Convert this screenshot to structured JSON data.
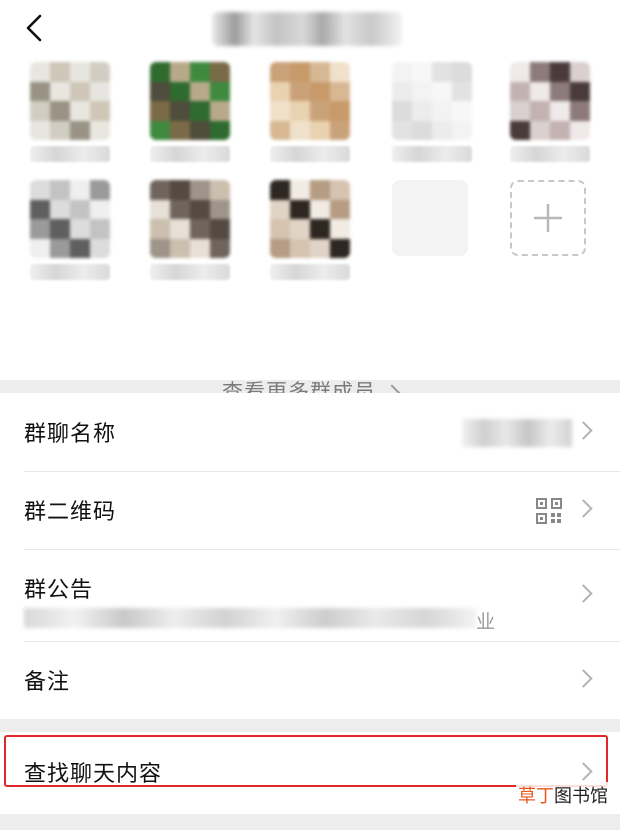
{
  "header": {
    "title_blurred": true
  },
  "members": [
    {
      "row": 0,
      "col": 0,
      "kind": "avatar",
      "colors": [
        "#e8e6df",
        "#d1cdc2",
        "#cfc6b8",
        "#9a9385",
        "#e7e5e0"
      ]
    },
    {
      "row": 0,
      "col": 1,
      "kind": "avatar",
      "colors": [
        "#3f8a3e",
        "#2f6b2f",
        "#7a6a47",
        "#b8a98a",
        "#4f4d3c"
      ]
    },
    {
      "row": 0,
      "col": 2,
      "kind": "avatar",
      "colors": [
        "#e9d2b0",
        "#d7b893",
        "#caa27a",
        "#f0e1cb",
        "#c89a6a"
      ]
    },
    {
      "row": 0,
      "col": 3,
      "kind": "avatar",
      "colors": [
        "#f7f7f7",
        "#ececec",
        "#e2e2e2",
        "#f3f3f3",
        "#dcdcdc"
      ]
    },
    {
      "row": 0,
      "col": 4,
      "kind": "avatar",
      "colors": [
        "#d9d0cf",
        "#8d7a7a",
        "#c4b2b2",
        "#4a3b3b",
        "#efe9e9"
      ]
    },
    {
      "row": 1,
      "col": 0,
      "kind": "avatar",
      "colors": [
        "#dcdcdc",
        "#9a9a9a",
        "#c3c3c3",
        "#5f5f5f",
        "#efefef"
      ]
    },
    {
      "row": 1,
      "col": 1,
      "kind": "avatar",
      "colors": [
        "#9e948a",
        "#6f655d",
        "#cbbfae",
        "#544a42",
        "#e7e0d6"
      ]
    },
    {
      "row": 1,
      "col": 2,
      "kind": "avatar",
      "colors": [
        "#e0d4c6",
        "#b59c83",
        "#2e2620",
        "#d6c3b0",
        "#f1ebe3"
      ]
    },
    {
      "row": 1,
      "col": 3,
      "kind": "empty"
    },
    {
      "row": 1,
      "col": 4,
      "kind": "add"
    }
  ],
  "see_more_label": "查看更多群成员",
  "settings": {
    "group_name_label": "群聊名称",
    "qr_code_label": "群二维码",
    "notice_label": "群公告",
    "notice_visible_tail": "业",
    "remark_label": "备注"
  },
  "search_label": "查找聊天内容",
  "watermark": {
    "accent": "草丁",
    "rest": "图书馆"
  },
  "colors": {
    "highlight": "#e0282b",
    "watermark_accent": "#e65a22",
    "background": "#ededed"
  }
}
